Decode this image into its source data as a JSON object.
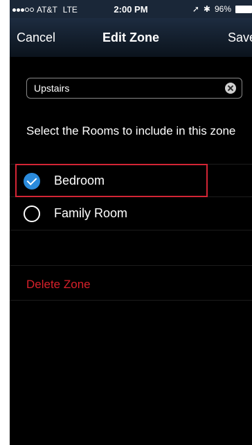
{
  "status_bar": {
    "carrier": "AT&T",
    "network": "LTE",
    "time": "2:00 PM",
    "battery": "96%"
  },
  "nav": {
    "cancel_label": "Cancel",
    "title": "Edit Zone",
    "save_label": "Save"
  },
  "zone_name": {
    "value": "Upstairs"
  },
  "instruction": "Select the Rooms to include in this zone",
  "rooms": [
    {
      "label": "Bedroom",
      "checked": true
    },
    {
      "label": "Family Room",
      "checked": false
    }
  ],
  "delete_label": "Delete Zone",
  "colors": {
    "accent_blue": "#2a8bdc",
    "delete_red": "#d8202a",
    "highlight_red": "#d32535"
  }
}
